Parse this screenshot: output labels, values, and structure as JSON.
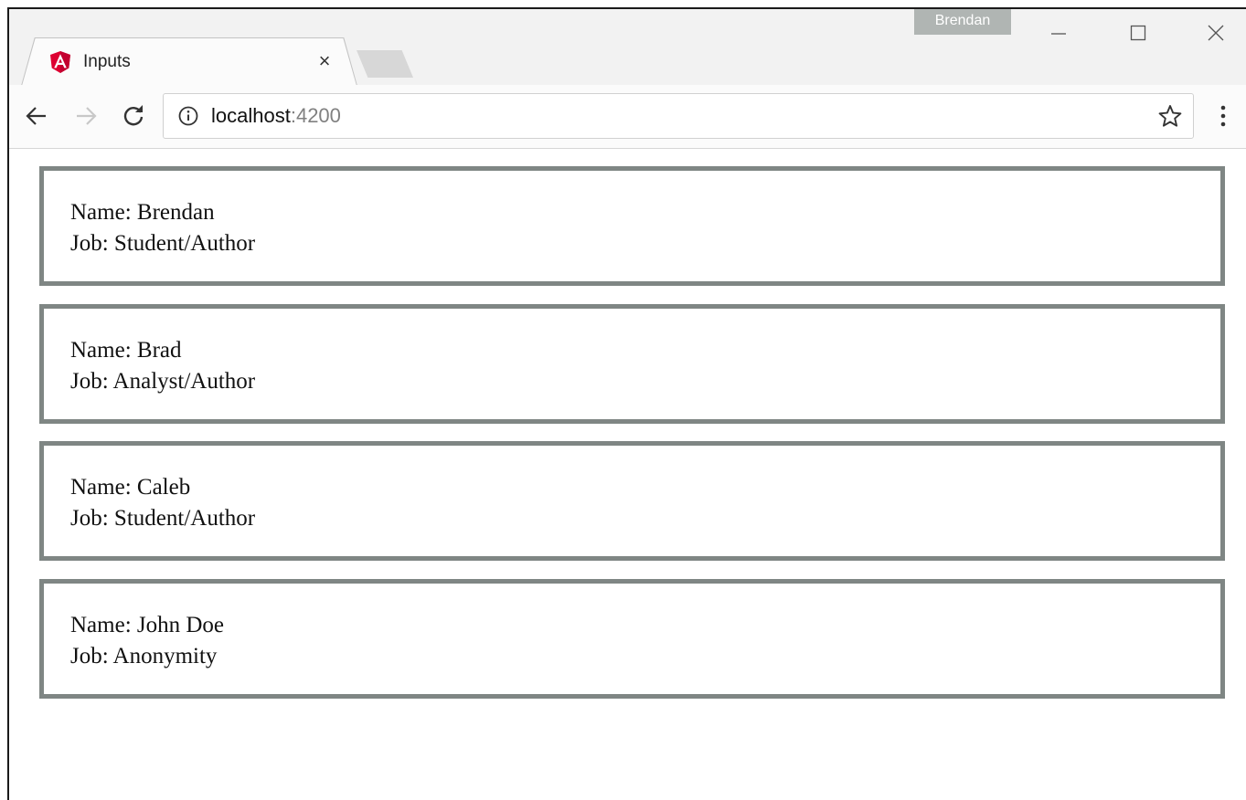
{
  "browser": {
    "tab": {
      "title": "Inputs",
      "close_glyph": "×",
      "favicon": "angular-icon"
    },
    "profile_name": "Brendan",
    "url": {
      "host": "localhost",
      "port": ":4200"
    }
  },
  "cards": [
    {
      "name_line": "Name: Brendan",
      "job_line": "Job: Student/Author"
    },
    {
      "name_line": "Name: Brad",
      "job_line": "Job: Analyst/Author"
    },
    {
      "name_line": "Name: Caleb",
      "job_line": "Job: Student/Author"
    },
    {
      "name_line": "Name: John Doe",
      "job_line": "Job: Anonymity"
    }
  ],
  "colors": {
    "card_border": "#7f8684",
    "angular_red": "#dd0031",
    "profile_badge": "#b0b5b3"
  }
}
